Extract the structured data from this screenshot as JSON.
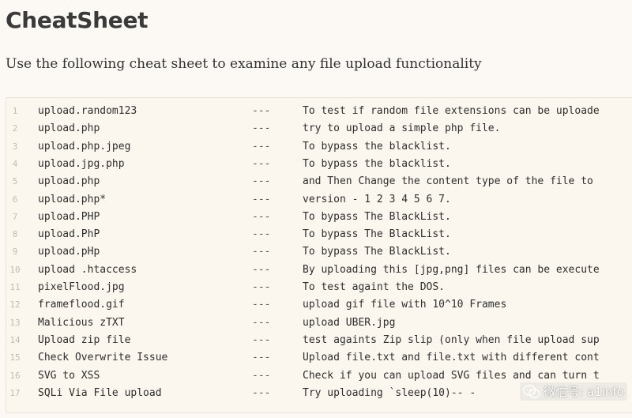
{
  "page": {
    "title": "CheatSheet",
    "intro": "Use the following cheat sheet to examine any file upload functionality"
  },
  "cheatsheet": {
    "rows": [
      {
        "ln": "1",
        "cmd": "upload.random123",
        "sep": "---",
        "desc": "To test if random file extensions can be uploade"
      },
      {
        "ln": "2",
        "cmd": "upload.php",
        "sep": "---",
        "desc": "try to upload a simple php file."
      },
      {
        "ln": "3",
        "cmd": "upload.php.jpeg",
        "sep": "---",
        "desc": "To bypass the blacklist."
      },
      {
        "ln": "4",
        "cmd": "upload.jpg.php",
        "sep": "---",
        "desc": "To bypass the blacklist."
      },
      {
        "ln": "5",
        "cmd": "upload.php",
        "sep": "---",
        "desc": "and Then Change the content type of the file to"
      },
      {
        "ln": "6",
        "cmd": "upload.php*",
        "sep": "---",
        "desc": "version - 1 2 3 4 5 6 7."
      },
      {
        "ln": "7",
        "cmd": "upload.PHP",
        "sep": "---",
        "desc": "To bypass The BlackList."
      },
      {
        "ln": "8",
        "cmd": "upload.PhP",
        "sep": "---",
        "desc": "To bypass The BlackList."
      },
      {
        "ln": "9",
        "cmd": "upload.pHp",
        "sep": "---",
        "desc": "To bypass The BlackList."
      },
      {
        "ln": "10",
        "cmd": "upload .htaccess",
        "sep": "---",
        "desc": "By uploading this [jpg,png] files can be execute"
      },
      {
        "ln": "11",
        "cmd": "pixelFlood.jpg",
        "sep": "---",
        "desc": "To test againt the DOS."
      },
      {
        "ln": "12",
        "cmd": "frameflood.gif",
        "sep": "---",
        "desc": "upload gif file with 10^10 Frames"
      },
      {
        "ln": "13",
        "cmd": "Malicious zTXT",
        "sep": "---",
        "desc": "upload UBER.jpg"
      },
      {
        "ln": "14",
        "cmd": "Upload zip file",
        "sep": "---",
        "desc": "test againts Zip slip (only when file upload sup"
      },
      {
        "ln": "15",
        "cmd": "Check Overwrite Issue",
        "sep": "---",
        "desc": "Upload file.txt and file.txt with different cont"
      },
      {
        "ln": "16",
        "cmd": "SVG to XSS",
        "sep": "---",
        "desc": "Check if you can upload SVG files and can turn t"
      },
      {
        "ln": "17",
        "cmd": "SQLi Via File upload",
        "sep": "---",
        "desc": "Try uploading `sleep(10)-- -"
      }
    ]
  },
  "watermark": {
    "icon": "wechat-icon",
    "text": "微信号: a1info"
  }
}
